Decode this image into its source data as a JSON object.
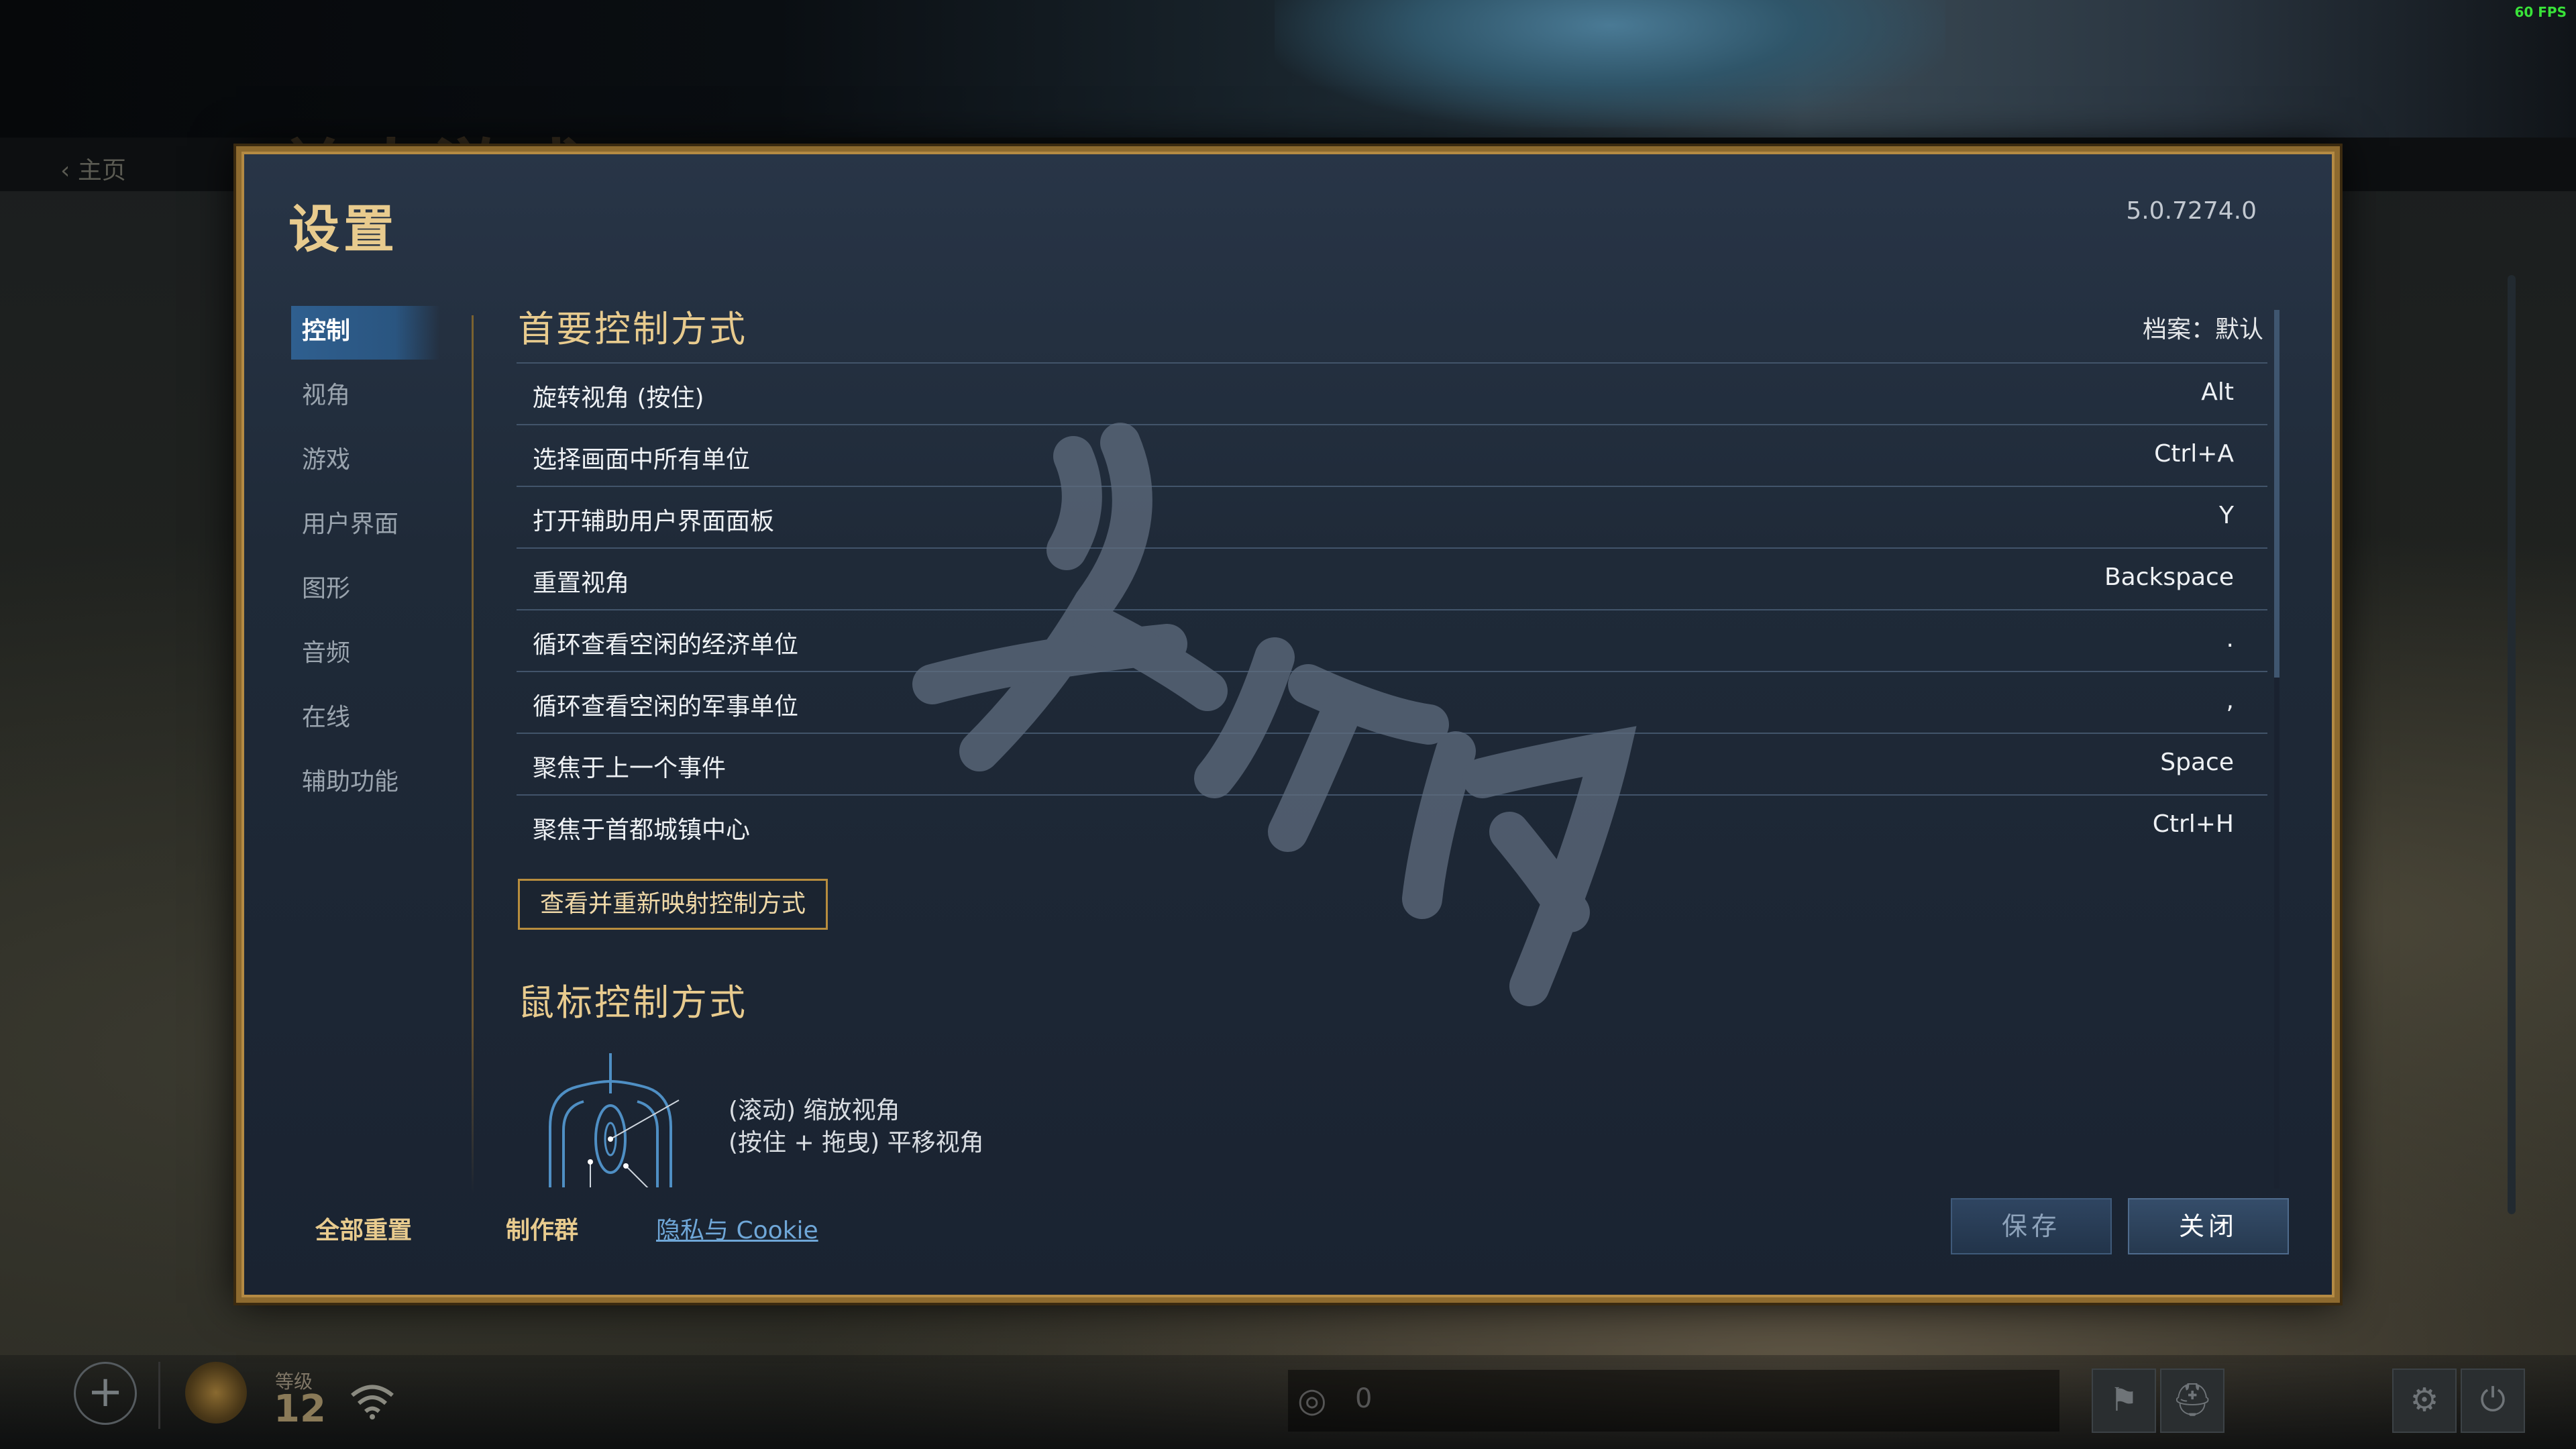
{
  "overlay": {
    "fps": "60 FPS"
  },
  "background": {
    "title": "单人游戏",
    "home_link": "主页",
    "level_label": "等级",
    "level_value": "12",
    "mid_counter": "0"
  },
  "settings": {
    "title": "设置",
    "version": "5.0.7274.0",
    "nav": [
      {
        "label": "控制",
        "active": true
      },
      {
        "label": "视角"
      },
      {
        "label": "游戏"
      },
      {
        "label": "用户界面"
      },
      {
        "label": "图形"
      },
      {
        "label": "音频"
      },
      {
        "label": "在线"
      },
      {
        "label": "辅助功能"
      }
    ],
    "primary": {
      "title": "首要控制方式",
      "profile": "档案：默认",
      "rows": [
        {
          "label": "旋转视角 (按住)",
          "key": "Alt"
        },
        {
          "label": "选择画面中所有单位",
          "key": "Ctrl+A"
        },
        {
          "label": "打开辅助用户界面面板",
          "key": "Y"
        },
        {
          "label": "重置视角",
          "key": "Backspace"
        },
        {
          "label": "循环查看空闲的经济单位",
          "key": "."
        },
        {
          "label": "循环查看空闲的军事单位",
          "key": ","
        },
        {
          "label": "聚焦于上一个事件",
          "key": "Space"
        },
        {
          "label": "聚焦于首都城镇中心",
          "key": "Ctrl+H"
        }
      ],
      "remap_button": "查看并重新映射控制方式"
    },
    "mouse": {
      "title": "鼠标控制方式",
      "line1": "(滚动) 缩放视角",
      "line2": "(按住 + 拖曳) 平移视角"
    },
    "footer": {
      "reset_all": "全部重置",
      "credits": "制作群",
      "privacy": "隐私与 Cookie",
      "save": "保存",
      "close": "关闭"
    },
    "watermark": "游侠网"
  },
  "colors": {
    "accent_gold": "#e8cb8e",
    "border_gold": "#8d6a2f",
    "panel_bg": "#1f2a38",
    "link_blue": "#6fa7d8",
    "active_tab": "#2f5f8f"
  }
}
